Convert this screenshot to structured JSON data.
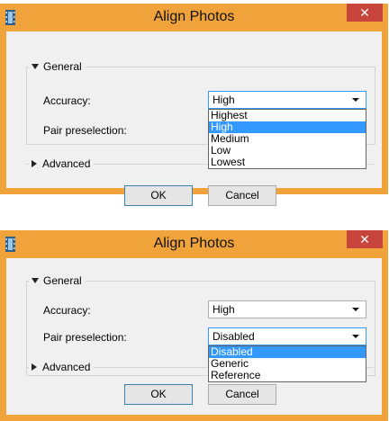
{
  "windows": [
    {
      "title": "Align Photos",
      "close_glyph": "✕",
      "general_label": "General",
      "accuracy_label": "Accuracy:",
      "accuracy_value": "High",
      "pair_label": "Pair preselection:",
      "advanced_label": "Advanced",
      "ok_label": "OK",
      "cancel_label": "Cancel",
      "dropdown": {
        "for": "accuracy",
        "options": [
          "Highest",
          "High",
          "Medium",
          "Low",
          "Lowest"
        ],
        "selected": "High"
      }
    },
    {
      "title": "Align Photos",
      "close_glyph": "✕",
      "general_label": "General",
      "accuracy_label": "Accuracy:",
      "accuracy_value": "High",
      "pair_label": "Pair preselection:",
      "pair_value": "Disabled",
      "advanced_label": "Advanced",
      "ok_label": "OK",
      "cancel_label": "Cancel",
      "dropdown": {
        "for": "pair-preselection",
        "options": [
          "Disabled",
          "Generic",
          "Reference"
        ],
        "selected": "Disabled"
      }
    }
  ],
  "colors": {
    "titlebar": "#f0a33a",
    "close": "#c7453c",
    "highlight": "#3399ff"
  }
}
